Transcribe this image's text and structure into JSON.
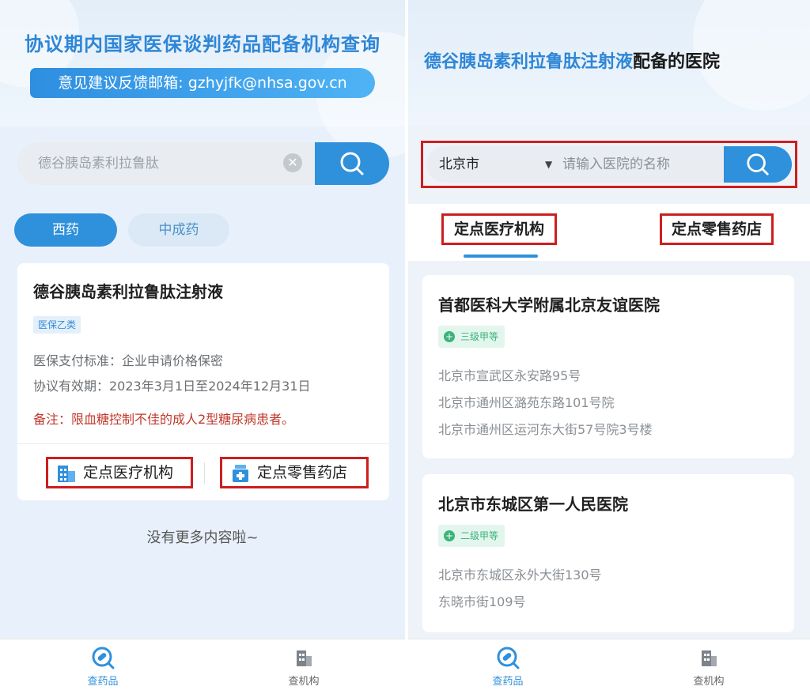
{
  "left": {
    "header_title": "协议期内国家医保谈判药品配备机构查询",
    "feedback_email": "意见建议反馈邮箱: gzhyjfk@nhsa.gov.cn",
    "search_value": "德谷胰岛素利拉鲁肽",
    "clear_icon": "clear-icon",
    "search_icon": "search-icon",
    "tabs": [
      {
        "label": "西药",
        "active": true
      },
      {
        "label": "中成药",
        "active": false
      }
    ],
    "drug": {
      "name": "德谷胰岛素利拉鲁肽注射液",
      "tag": "医保乙类",
      "payment_standard": "医保支付标准：企业申请价格保密",
      "validity": "协议有效期：2023年3月1日至2024年12月31日",
      "note": "备注：限血糖控制不佳的成人2型糖尿病患者。",
      "action_institution": "定点医疗机构",
      "action_pharmacy": "定点零售药店"
    },
    "no_more": "没有更多内容啦~"
  },
  "right": {
    "header_drug": "德谷胰岛素利拉鲁肽注射液",
    "header_suffix": "配备的医院",
    "city": "北京市",
    "search_placeholder": "请输入医院的名称",
    "tabs": [
      {
        "label": "定点医疗机构",
        "active": true
      },
      {
        "label": "定点零售药店",
        "active": false
      }
    ],
    "hospitals": [
      {
        "name": "首都医科大学附属北京友谊医院",
        "level": "三级甲等",
        "addresses": [
          "北京市宣武区永安路95号",
          "北京市通州区潞苑东路101号院",
          "北京市通州区运河东大街57号院3号楼"
        ]
      },
      {
        "name": "北京市东城区第一人民医院",
        "level": "二级甲等",
        "addresses": [
          "北京市东城区永外大街130号",
          "东晓市街109号"
        ]
      }
    ]
  },
  "bottom_nav": [
    {
      "label": "查药品",
      "icon": "pill-search-icon",
      "active": true
    },
    {
      "label": "查机构",
      "icon": "building-icon",
      "active": false
    }
  ],
  "colors": {
    "accent": "#2f90dc",
    "highlight_box": "#cc1f1f",
    "note_red": "#c0392b",
    "level_green": "#3bb37a"
  }
}
